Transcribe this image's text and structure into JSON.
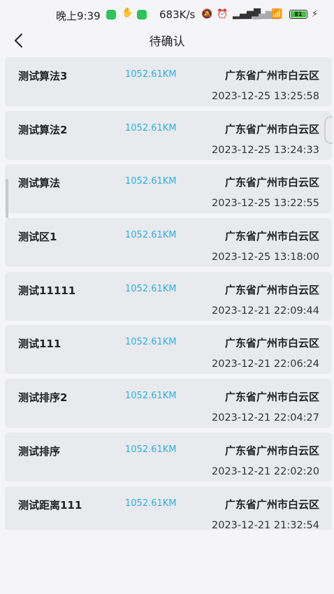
{
  "status_bar": {
    "time": "晚上9:39",
    "network_speed": "683K/s",
    "battery": "81"
  },
  "header": {
    "title": "待确认"
  },
  "items": [
    {
      "name": "测试算法3",
      "distance": "1052.61KM",
      "address": "广东省广州市白云区",
      "time": "2023-12-25 13:25:58"
    },
    {
      "name": "测试算法2",
      "distance": "1052.61KM",
      "address": "广东省广州市白云区",
      "time": "2023-12-25 13:24:33"
    },
    {
      "name": "测试算法",
      "distance": "1052.61KM",
      "address": "广东省广州市白云区",
      "time": "2023-12-25 13:22:55"
    },
    {
      "name": "测试区1",
      "distance": "1052.61KM",
      "address": "广东省广州市白云区",
      "time": "2023-12-25 13:18:00"
    },
    {
      "name": "测试11111",
      "distance": "1052.61KM",
      "address": "广东省广州市白云区",
      "time": "2023-12-21 22:09:44"
    },
    {
      "name": "测试111",
      "distance": "1052.61KM",
      "address": "广东省广州市白云区",
      "time": "2023-12-21 22:06:24"
    },
    {
      "name": "测试排序2",
      "distance": "1052.61KM",
      "address": "广东省广州市白云区",
      "time": "2023-12-21 22:04:27"
    },
    {
      "name": "测试排序",
      "distance": "1052.61KM",
      "address": "广东省广州市白云区",
      "time": "2023-12-21 22:02:20"
    },
    {
      "name": "测试距离111",
      "distance": "1052.61KM",
      "address": "广东省广州市白云区",
      "time": "2023-12-21 21:32:54"
    }
  ],
  "icons": {
    "back": "chevron-left-icon",
    "wechat": "wechat-icon",
    "alarm": "alarm-icon",
    "wifi": "wifi-icon",
    "signal": "signal-icon"
  },
  "colors": {
    "distance": "#2ab0e0",
    "card_bg": "#e9eaee",
    "page_bg": "#f5f5f7"
  }
}
